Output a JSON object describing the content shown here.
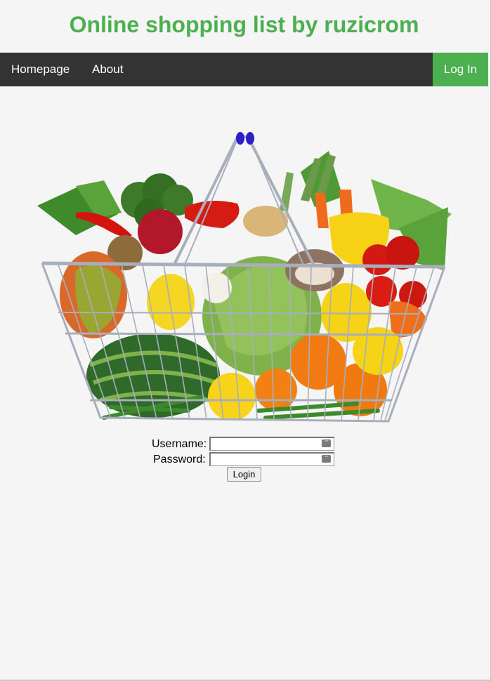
{
  "header": {
    "title": "Online shopping list by ruzicrom"
  },
  "nav": {
    "items": [
      {
        "label": "Homepage"
      },
      {
        "label": "About"
      }
    ],
    "login_label": "Log In"
  },
  "login_form": {
    "username_label": "Username:",
    "username_value": "",
    "password_label": "Password:",
    "password_value": "",
    "submit_label": "Login"
  },
  "colors": {
    "accent": "#4caf50",
    "navbar": "#333333",
    "background": "#f5f5f5"
  },
  "icons": {
    "input_icon": "password-manager-key-icon",
    "hero": "vegetable-basket-image"
  }
}
